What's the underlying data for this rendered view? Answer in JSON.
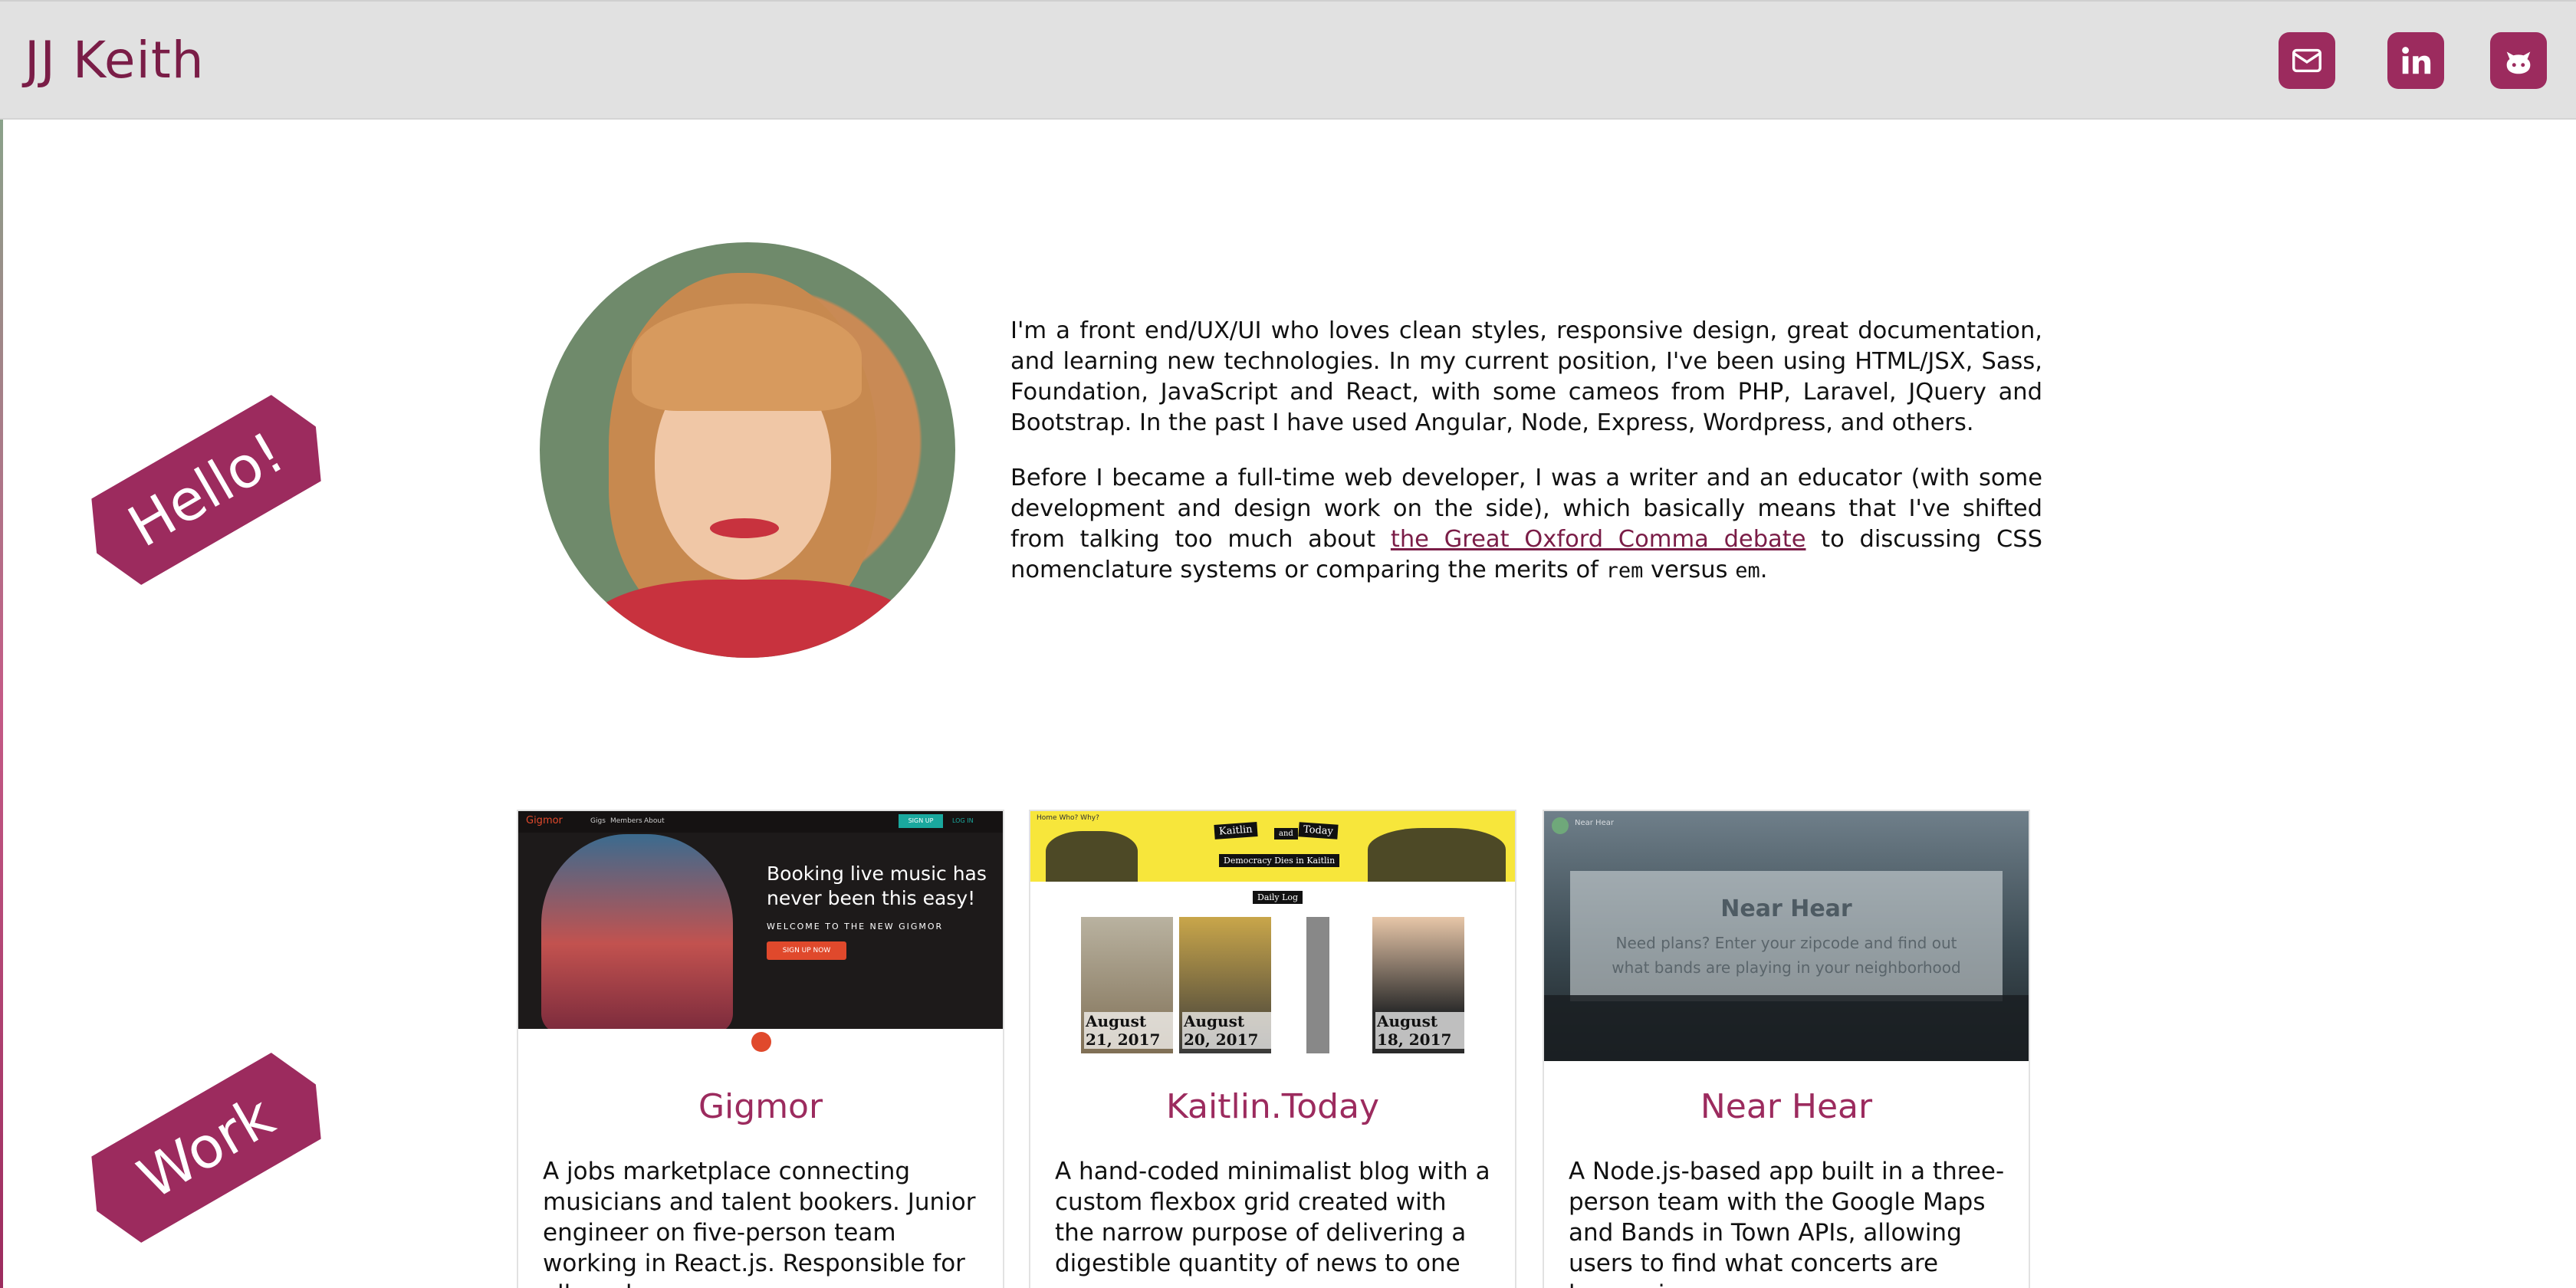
{
  "header": {
    "brand": "JJ Keith",
    "social": [
      {
        "name": "email",
        "icon": "envelope-icon"
      },
      {
        "name": "linkedin",
        "icon": "linkedin-icon"
      },
      {
        "name": "github",
        "icon": "github-icon"
      }
    ]
  },
  "hello": {
    "ribbon": "Hello!",
    "intro_p1": "I'm a front end/UX/UI who loves clean styles, responsive design, great documentation, and learning new technologies. In my current position, I've been using HTML/JSX, Sass, Foundation, JavaScript and React, with some cameos from PHP, Laravel, JQuery and Bootstrap. In the past I have used Angular, Node, Express, Wordpress, and others.",
    "intro_p2_before": "Before I became a full-time web developer, I was a writer and an educator (with some development and design work on the side), which basically means that I've shifted from talking too much about ",
    "intro_p2_link": "the Great Oxford Comma debate",
    "intro_p2_mid": " to discussing CSS nomenclature systems or comparing the merits of ",
    "code_rem": "rem",
    "versus": " versus ",
    "code_em": "em",
    "period": "."
  },
  "work": {
    "ribbon": "Work",
    "cards": [
      {
        "title": "Gigmor",
        "desc": "A jobs marketplace connecting musicians and talent bookers. Junior engineer on five-person team working in React.js. Responsible for all markup",
        "shot": {
          "nav_items": [
            "Gigs",
            "Members",
            "About"
          ],
          "signup": "SIGN UP",
          "login": "LOG IN",
          "tagline": "Booking live music has never been this easy!",
          "welcome": "WELCOME TO THE NEW GIGMOR",
          "button": "SIGN UP NOW"
        }
      },
      {
        "title": "Kaitlin.Today",
        "desc": "A hand-coded minimalist blog with a custom flexbox grid created with the narrow purpose of delivering a digestible quantity of news to one",
        "shot": {
          "nav": "Home   Who? Why?",
          "tag1": "Kaitlin",
          "tag2": "and",
          "tag3": "Today",
          "headline": "Democracy Dies in Kaitlin",
          "daily": "Daily Log",
          "dates": [
            "August 21, 2017",
            "August 20, 2017",
            "August 18, 2017"
          ]
        }
      },
      {
        "title": "Near Hear",
        "desc": "A Node.js-based app built in a three-person team with the Google Maps and Bands in Town APIs, allowing users to find what concerts are happening near",
        "shot": {
          "logo_text": "Near Hear",
          "title": "Near Hear",
          "text": "Need plans? Enter your zipcode and find out what bands are playing in your neighborhood"
        }
      }
    ]
  },
  "colors": {
    "accent": "#9c2b5e",
    "brand": "#7a1d47",
    "header_bg": "#e1e1e1"
  }
}
